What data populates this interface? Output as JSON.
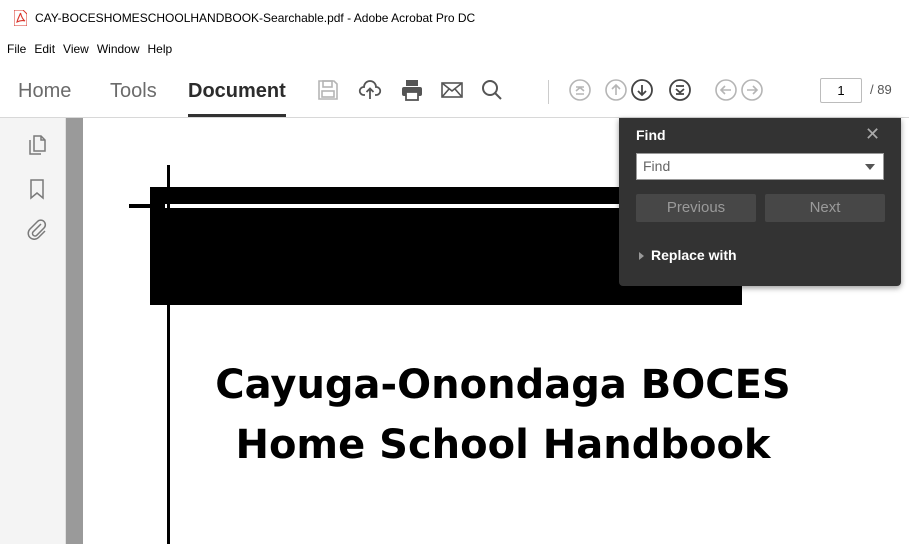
{
  "window": {
    "title": "CAY-BOCESHOMESCHOOLHANDBOOK-Searchable.pdf - Adobe Acrobat Pro DC",
    "icon": "pdf-icon",
    "accent": "#d9342b"
  },
  "menu": [
    "File",
    "Edit",
    "View",
    "Window",
    "Help"
  ],
  "toolbar": {
    "tabs": [
      {
        "label": "Home",
        "active": false
      },
      {
        "label": "Tools",
        "active": false
      },
      {
        "label": "Document",
        "active": true
      }
    ],
    "icons": [
      "save-icon",
      "upload-cloud-icon",
      "print-icon",
      "email-icon",
      "search-icon",
      "first-page-icon",
      "previous-page-icon",
      "next-page-icon",
      "last-page-icon",
      "back-view-icon",
      "forward-view-icon"
    ],
    "page_current": "1",
    "page_total": "/ 89"
  },
  "left_panel": {
    "icons": [
      "page-thumbnails-icon",
      "bookmark-icon",
      "attachment-icon"
    ]
  },
  "document": {
    "title_line1": "Cayuga-Onondaga BOCES",
    "title_line2": "Home School Handbook"
  },
  "find_panel": {
    "title": "Find",
    "input_placeholder": "Find",
    "previous_label": "Previous",
    "next_label": "Next",
    "replace_label": "Replace with"
  }
}
